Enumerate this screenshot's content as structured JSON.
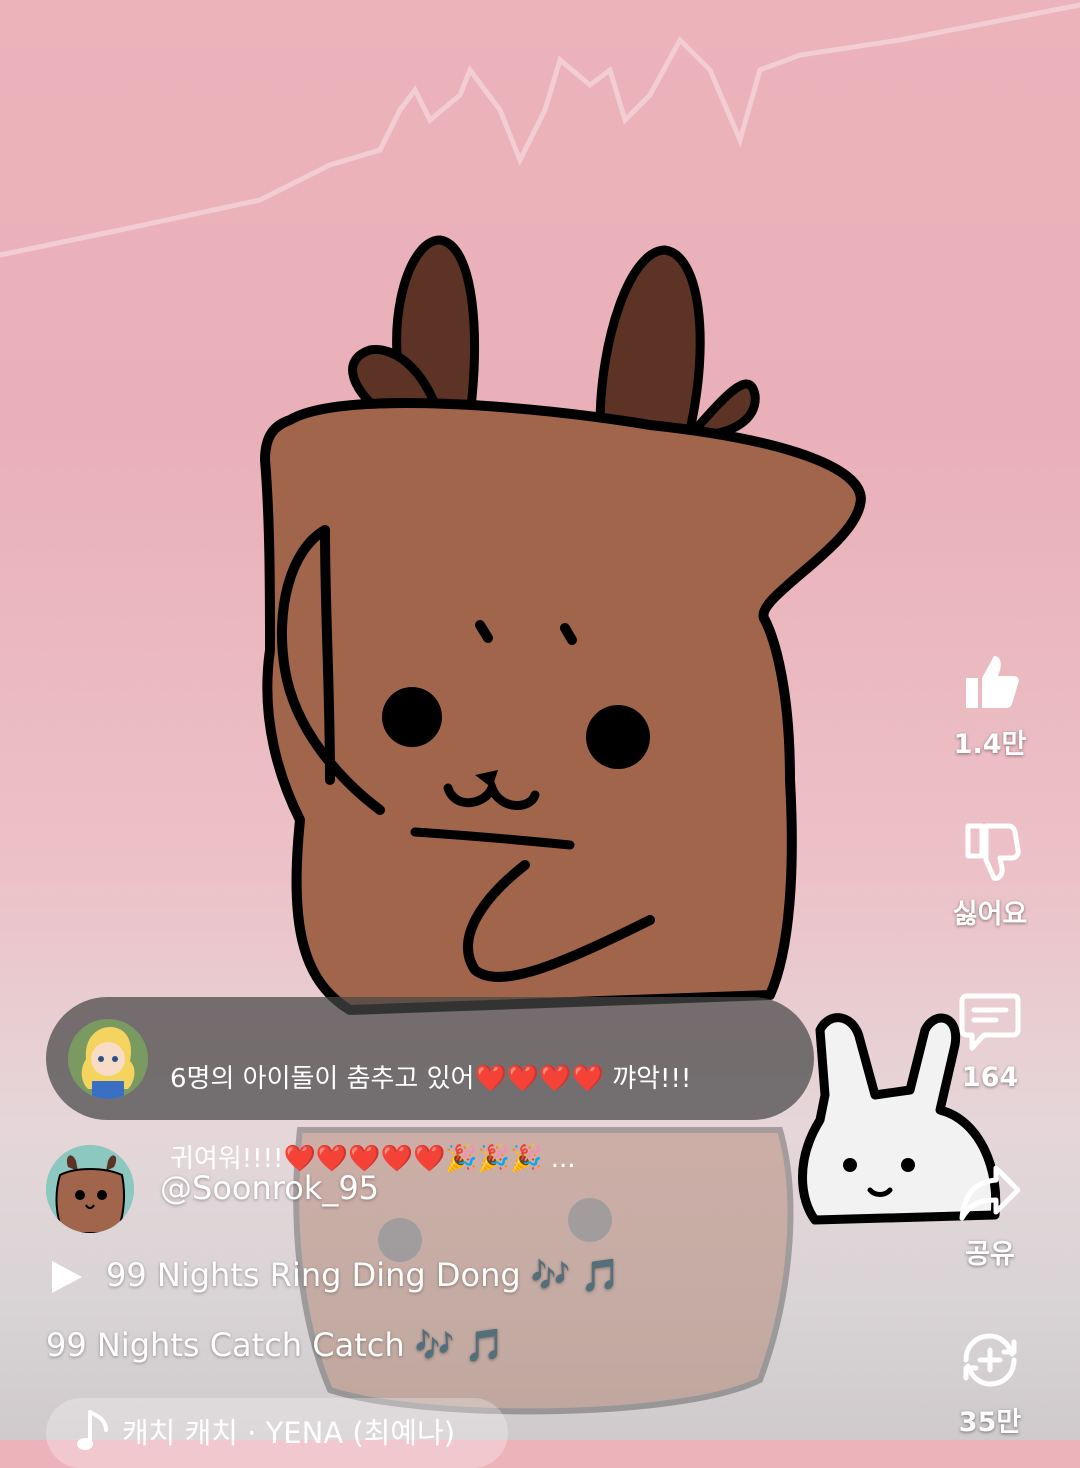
{
  "actions": {
    "like_count": "1.4만",
    "dislike_label": "싫어요",
    "comment_count": "164",
    "share_label": "공유",
    "remix_count": "35만"
  },
  "comment": {
    "line1": "6명의 아이돌이 춤추고 있어❤️❤️❤️❤️ 꺄악!!!",
    "line2": "귀여워!!!!❤️❤️❤️❤️❤️🎉🎉🎉 ..."
  },
  "channel": {
    "handle": "@Soonrok_95"
  },
  "video": {
    "title": "99 Nights Ring Ding Dong 🎶 🎵",
    "subtitle": "99 Nights Catch Catch 🎶 🎵"
  },
  "music": {
    "song": "캐치 캐치 · YENA (최예나)"
  },
  "colors": {
    "background_top": "#ecb3bb",
    "background_bottom": "#cfcacc",
    "deer_fur": "#a0654a",
    "deer_antler": "#5c3324",
    "overlay": "#464646"
  }
}
